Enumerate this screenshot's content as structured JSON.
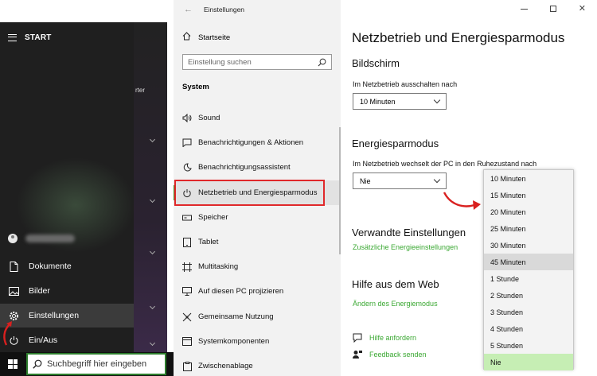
{
  "start_menu": {
    "title": "START",
    "fragment_text": "rter",
    "items": [
      {
        "label": "Dokumente",
        "icon": "document-icon"
      },
      {
        "label": "Bilder",
        "icon": "pictures-icon"
      },
      {
        "label": "Einstellungen",
        "icon": "gear-icon"
      },
      {
        "label": "Ein/Aus",
        "icon": "power-icon"
      }
    ]
  },
  "taskbar": {
    "search_placeholder": "Suchbegriff hier eingeben"
  },
  "settings": {
    "app_title": "Einstellungen",
    "home_label": "Startseite",
    "search_placeholder": "Einstellung suchen",
    "section": "System",
    "nav_items": [
      {
        "label": "Sound",
        "icon": "speaker-icon"
      },
      {
        "label": "Benachrichtigungen & Aktionen",
        "icon": "notification-icon"
      },
      {
        "label": "Benachrichtigungsassistent",
        "icon": "moon-icon"
      },
      {
        "label": "Netzbetrieb und Energiesparmodus",
        "icon": "power-icon"
      },
      {
        "label": "Speicher",
        "icon": "storage-icon"
      },
      {
        "label": "Tablet",
        "icon": "tablet-icon"
      },
      {
        "label": "Multitasking",
        "icon": "multitasking-icon"
      },
      {
        "label": "Auf diesen PC projizieren",
        "icon": "project-icon"
      },
      {
        "label": "Gemeinsame Nutzung",
        "icon": "share-icon"
      },
      {
        "label": "Systemkomponenten",
        "icon": "components-icon"
      },
      {
        "label": "Zwischenablage",
        "icon": "clipboard-icon"
      }
    ],
    "active_index": 3
  },
  "content": {
    "title": "Netzbetrieb und Energiesparmodus",
    "screen_heading": "Bildschirm",
    "screen_label": "Im Netzbetrieb ausschalten nach",
    "screen_value": "10 Minuten",
    "sleep_heading": "Energiesparmodus",
    "sleep_label": "Im Netzbetrieb wechselt der PC in den Ruhezustand nach",
    "sleep_value": "Nie",
    "related_heading": "Verwandte Einstellungen",
    "related_link": "Zusätzliche Energieeinstellungen",
    "help_heading": "Hilfe aus dem Web",
    "help_link": "Ändern des Energiemodus",
    "get_help": "Hilfe anfordern",
    "feedback": "Feedback senden"
  },
  "dropdown_options": [
    "10 Minuten",
    "15 Minuten",
    "20 Minuten",
    "25 Minuten",
    "30 Minuten",
    "45 Minuten",
    "1 Stunde",
    "2 Stunden",
    "3 Stunden",
    "4 Stunden",
    "5 Stunden",
    "Nie"
  ],
  "dropdown_hover_index": 5,
  "dropdown_selected_index": 11,
  "colors": {
    "accent_green": "#3aa832",
    "highlight_red": "#e0282a",
    "selected_option": "#c6eeb4"
  }
}
